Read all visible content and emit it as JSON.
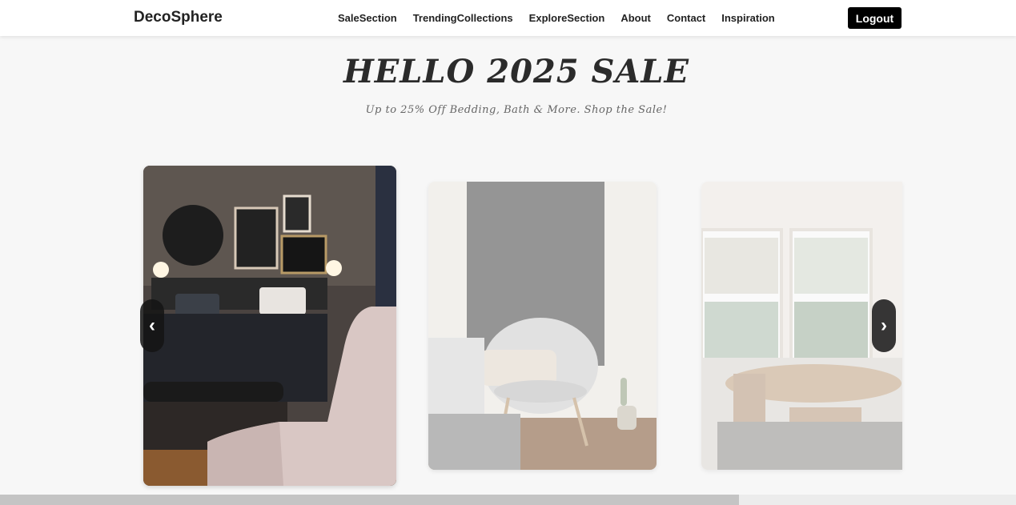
{
  "navbar": {
    "brand": "DecoSphere",
    "links": [
      "SaleSection",
      "TrendingCollections",
      "ExploreSection",
      "About",
      "Contact",
      "Inspiration"
    ],
    "logout_label": "Logout"
  },
  "hero": {
    "title": "HELLO 2025 SALE",
    "subtitle": "Up to 25% Off Bedding, Bath & More. Shop the Sale!"
  },
  "carousel": {
    "prev_icon": "‹",
    "next_icon": "›",
    "progress": 0.727
  }
}
